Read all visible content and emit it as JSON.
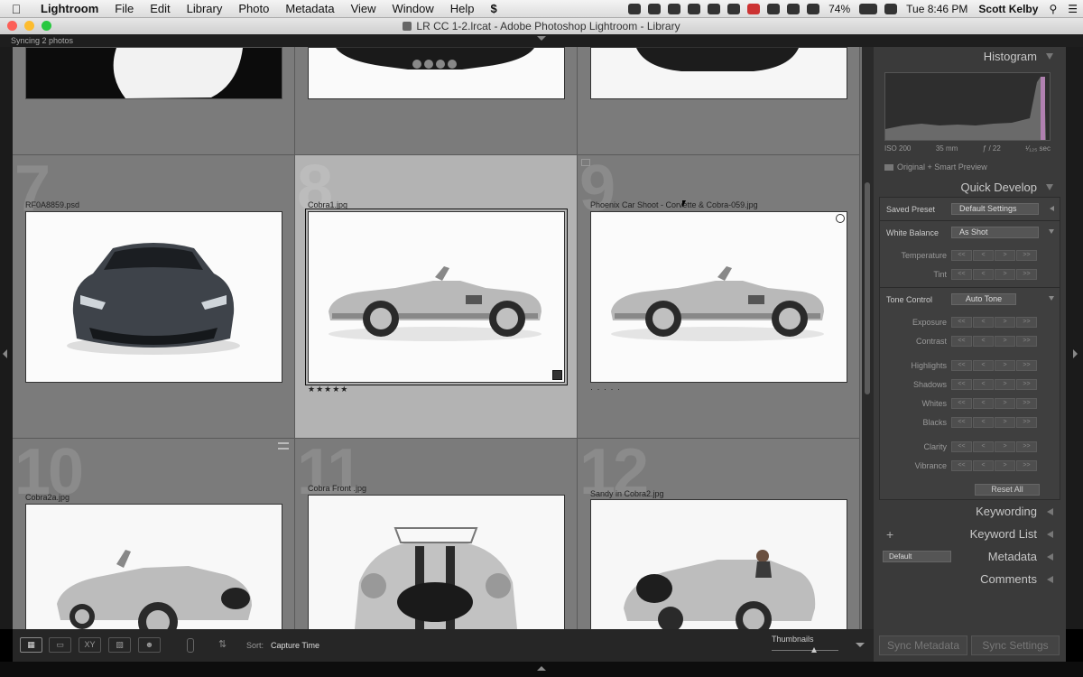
{
  "menubar": {
    "app": "Lightroom",
    "items": [
      "File",
      "Edit",
      "Library",
      "Photo",
      "Metadata",
      "View",
      "Window",
      "Help"
    ],
    "battery": "74%",
    "clock": "Tue 8:46 PM",
    "user": "Scott Kelby"
  },
  "window": {
    "title": "LR CC 1-2.lrcat - Adobe Photoshop Lightroom - Library",
    "sync_status": "Syncing 2 photos"
  },
  "grid": {
    "cells": [
      {
        "num": "7",
        "filename": "RF0A8859.psd",
        "stars": ""
      },
      {
        "num": "8",
        "filename": "Cobra1.jpg",
        "stars": "★★★★★"
      },
      {
        "num": "9",
        "filename": "Phoenix Car Shoot - Corvette & Cobra-059.jpg",
        "stars": "· · · · ·"
      },
      {
        "num": "10",
        "filename": "Cobra2a.jpg",
        "stars": ""
      },
      {
        "num": "11",
        "filename": "Cobra Front .jpg",
        "stars": ""
      },
      {
        "num": "12",
        "filename": "Sandy in Cobra2.jpg",
        "stars": ""
      }
    ]
  },
  "panel": {
    "histogram": {
      "title": "Histogram",
      "iso": "ISO 200",
      "focal": "35 mm",
      "aperture": "ƒ / 22",
      "shutter": "¹⁄₁₂₅ sec",
      "preview": "Original + Smart Preview"
    },
    "quick_develop": {
      "title": "Quick Develop",
      "saved_preset_label": "Saved Preset",
      "saved_preset_value": "Default Settings",
      "white_balance_label": "White Balance",
      "white_balance_value": "As Shot",
      "tone_control_label": "Tone Control",
      "auto_tone": "Auto Tone",
      "reset_all": "Reset All",
      "temperature": "Temperature",
      "tint": "Tint",
      "exposure": "Exposure",
      "contrast": "Contrast",
      "highlights": "Highlights",
      "shadows": "Shadows",
      "whites": "Whites",
      "blacks": "Blacks",
      "clarity": "Clarity",
      "vibrance": "Vibrance"
    },
    "keywording": "Keywording",
    "keyword_list": "Keyword List",
    "metadata": "Metadata",
    "metadata_preset": "Default",
    "comments": "Comments",
    "sync_metadata": "Sync Metadata",
    "sync_settings": "Sync Settings"
  },
  "toolbar": {
    "sort_label": "Sort:",
    "sort_value": "Capture Time",
    "thumbnails_label": "Thumbnails"
  }
}
